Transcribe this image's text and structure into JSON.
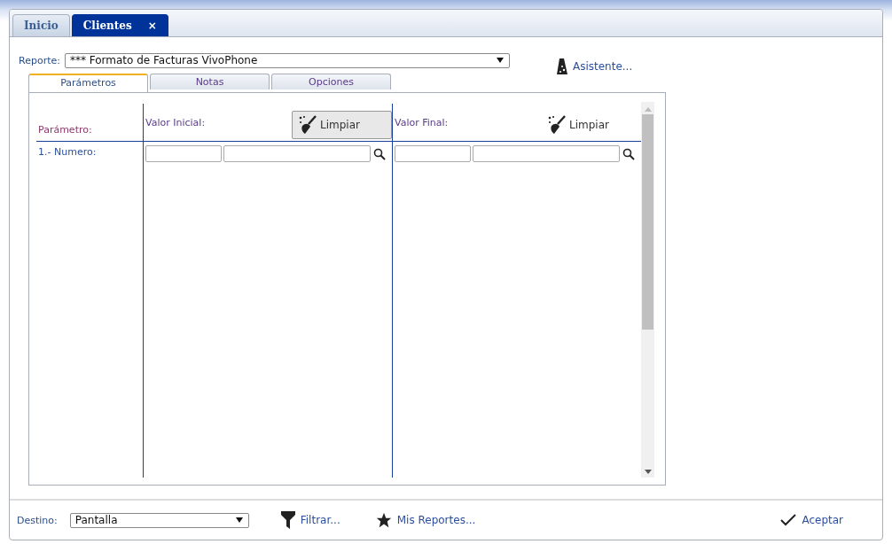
{
  "tabs": [
    {
      "label": "Inicio",
      "selected": false
    },
    {
      "label": "Clientes",
      "selected": true,
      "close": "×"
    }
  ],
  "report": {
    "label": "Reporte:",
    "value": "*** Formato de Facturas VivoPhone"
  },
  "assistant": "Asistente...",
  "subtabs": [
    {
      "label": "Parámetros",
      "selected": true
    },
    {
      "label": "Notas",
      "selected": false
    },
    {
      "label": "Opciones",
      "selected": false
    }
  ],
  "grid": {
    "param_header": "Parámetro:",
    "ranges": [
      {
        "header": "Valor Inicial:",
        "clear": "Limpiar",
        "highlighted": true
      },
      {
        "header": "Valor Final:",
        "clear": "Limpiar",
        "highlighted": false
      }
    ],
    "rows": [
      {
        "label": "1.- Numero:"
      }
    ]
  },
  "footer": {
    "label": "Destino:",
    "value": "Pantalla",
    "filter": "Filtrar...",
    "my_reports": "Mis Reportes...",
    "accept": "Aceptar"
  }
}
